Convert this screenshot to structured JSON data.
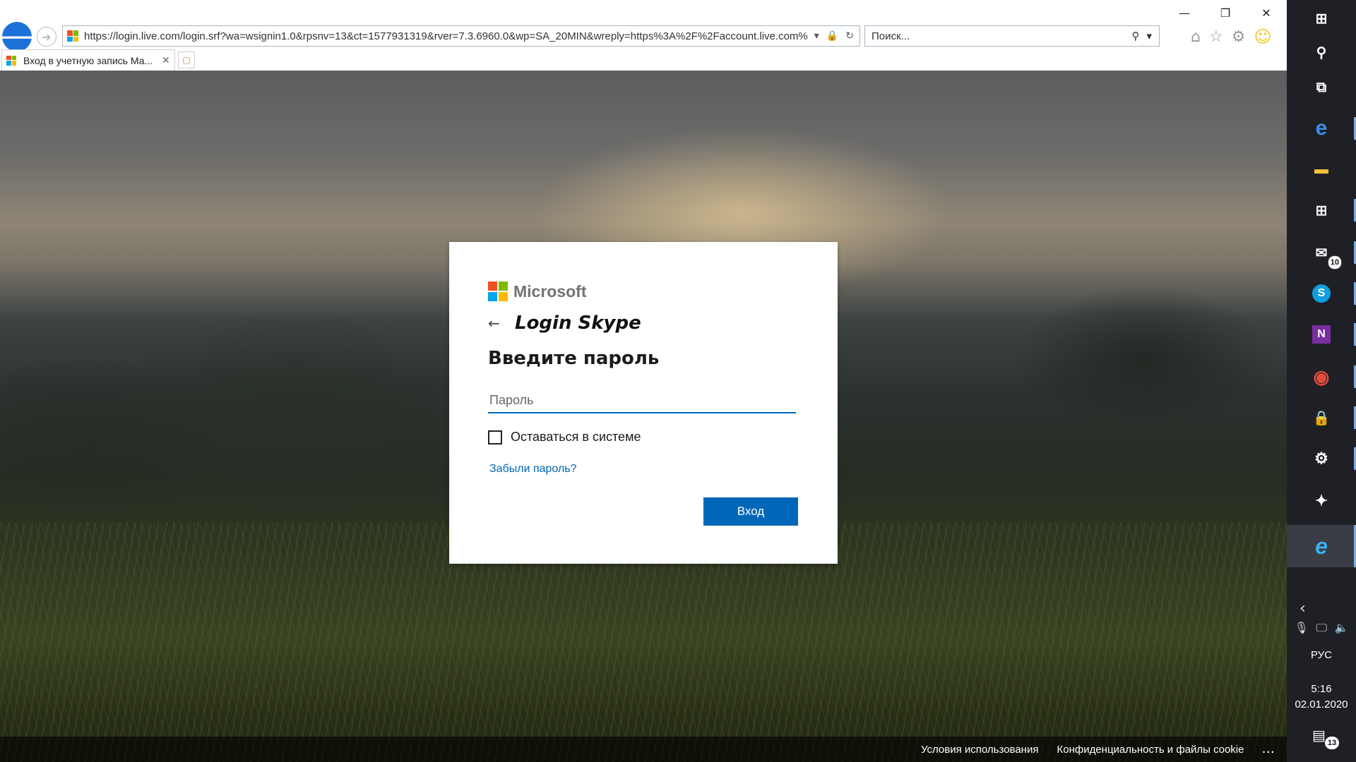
{
  "browser": {
    "url": "https://login.live.com/login.srf?wa=wsignin1.0&rpsnv=13&ct=1577931319&rver=7.3.6960.0&wp=SA_20MIN&wreply=https%3A%2F%2Faccount.live.com%",
    "search_placeholder": "Поиск...",
    "tab_title": "Вход в учетную запись Ма...",
    "tab_close": "✕",
    "window_controls": {
      "minimize": "—",
      "restore": "❐",
      "close": "✕"
    }
  },
  "signin": {
    "brand": "Microsoft",
    "back_arrow": "←",
    "identity": "Login Skype",
    "heading": "Введите пароль",
    "password_placeholder": "Пароль",
    "stay_signed_in": "Оставаться в системе",
    "forgot_password": "Забыли пароль?",
    "signin_button": "Вход",
    "brand_colors": [
      "#f25022",
      "#7fba00",
      "#00a4ef",
      "#ffb900"
    ]
  },
  "footer": {
    "terms": "Условия использования",
    "privacy": "Конфиденциальность и файлы cookie",
    "more": "..."
  },
  "taskbar": {
    "items": [
      {
        "name": "start-icon",
        "glyph": "⊞"
      },
      {
        "name": "search-icon",
        "glyph": "⚲"
      },
      {
        "name": "task-view-icon",
        "glyph": "⧉"
      },
      {
        "name": "edge-icon",
        "glyph": "e"
      },
      {
        "name": "file-explorer-icon",
        "glyph": "▬"
      },
      {
        "name": "store-icon",
        "glyph": "⊞"
      },
      {
        "name": "mail-icon",
        "glyph": "✉",
        "badge": "10"
      },
      {
        "name": "skype-icon",
        "glyph": "S"
      },
      {
        "name": "onenote-icon",
        "glyph": "N"
      },
      {
        "name": "chrome-icon",
        "glyph": "◉"
      },
      {
        "name": "keepass-icon",
        "glyph": "🔒"
      },
      {
        "name": "steam-icon",
        "glyph": "⚙"
      },
      {
        "name": "game-icon",
        "glyph": "✦"
      },
      {
        "name": "internet-explorer-icon",
        "glyph": "e"
      }
    ],
    "language": "РУС",
    "time": "5:16",
    "date": "02.01.2020",
    "notifications_badge": "13"
  }
}
